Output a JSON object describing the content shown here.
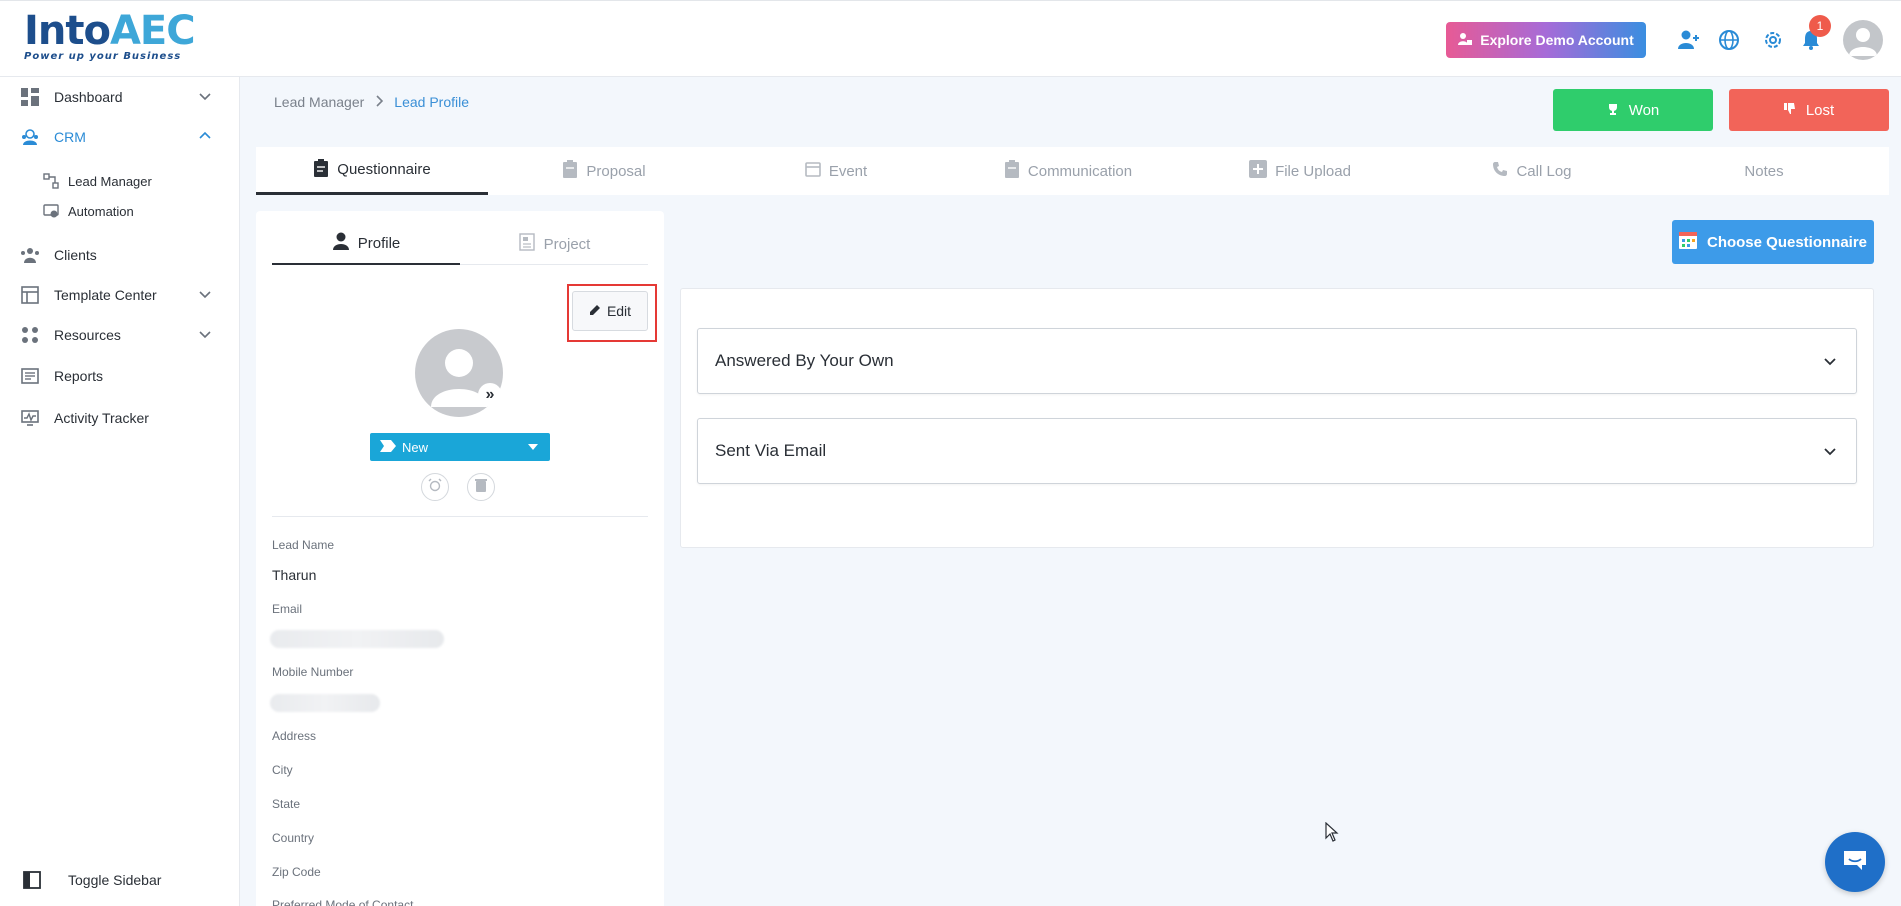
{
  "header": {
    "logo_main_a": "Into",
    "logo_main_b": "AEC",
    "logo_tagline": "Power up your Business",
    "demo_button": "Explore Demo Account",
    "notification_count": "1"
  },
  "sidebar": {
    "items": [
      {
        "label": "Dashboard"
      },
      {
        "label": "CRM"
      },
      {
        "label": "Lead Manager"
      },
      {
        "label": "Automation"
      },
      {
        "label": "Clients"
      },
      {
        "label": "Template Center"
      },
      {
        "label": "Resources"
      },
      {
        "label": "Reports"
      },
      {
        "label": "Activity Tracker"
      }
    ],
    "toggle_label": "Toggle Sidebar"
  },
  "breadcrumb": {
    "parent": "Lead Manager",
    "current": "Lead Profile"
  },
  "actions": {
    "won": "Won",
    "lost": "Lost"
  },
  "tabs": [
    {
      "label": "Questionnaire"
    },
    {
      "label": "Proposal"
    },
    {
      "label": "Event"
    },
    {
      "label": "Communication"
    },
    {
      "label": "File Upload"
    },
    {
      "label": "Call Log"
    },
    {
      "label": "Notes"
    }
  ],
  "profile": {
    "tabs": {
      "profile": "Profile",
      "project": "Project"
    },
    "edit_button": "Edit",
    "status": "New",
    "fields": {
      "lead_name_label": "Lead Name",
      "lead_name_value": "Tharun",
      "email_label": "Email",
      "mobile_label": "Mobile Number",
      "address_label": "Address",
      "city_label": "City",
      "state_label": "State",
      "country_label": "Country",
      "zip_label": "Zip Code",
      "preferred_label": "Preferred Mode of Contact"
    }
  },
  "questionnaire": {
    "choose_button": "Choose Questionnaire",
    "sections": [
      {
        "title": "Answered By Your Own"
      },
      {
        "title": "Sent Via Email"
      }
    ]
  },
  "colors": {
    "won": "#2fcd6c",
    "lost": "#f26459",
    "accent": "#3d9be9",
    "status": "#1aa6d8"
  }
}
